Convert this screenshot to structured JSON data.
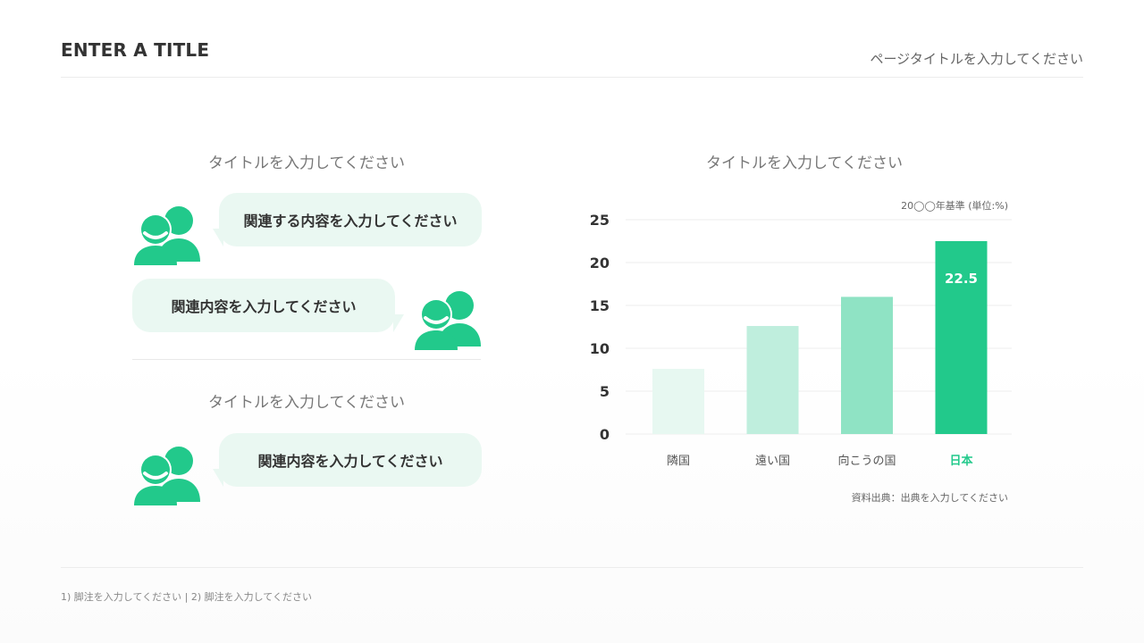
{
  "header": {
    "title": "ENTER A TITLE",
    "page_title": "ページタイトルを入力してください"
  },
  "left": {
    "section1": {
      "title": "タイトルを入力してください",
      "bubble1": "関連する内容を入力してください",
      "bubble2": "関連内容を入力してください"
    },
    "section2": {
      "title": "タイトルを入力してください",
      "bubble1": "関連内容を入力してください"
    }
  },
  "chart_section": {
    "title": "タイトルを入力してください",
    "note": "20◯◯年基準 (単位:%)",
    "source": "資料出典：出典を入力してください"
  },
  "chart_data": {
    "type": "bar",
    "title": "タイトルを入力してください",
    "categories": [
      "隣国",
      "遠い国",
      "向こうの国",
      "日本"
    ],
    "values": [
      7.6,
      12.6,
      16.0,
      22.5
    ],
    "ylim": [
      0,
      25
    ],
    "yticks": [
      0,
      5,
      10,
      15,
      20,
      25
    ],
    "grid": true,
    "highlight_index": 3,
    "highlight_label": "22.5",
    "colors": [
      "#e7f8f1",
      "#bfeedd",
      "#8fe3c4",
      "#22c98b"
    ],
    "highlight_color": "#22c98b"
  },
  "footer": {
    "footnote": "1) 脚注を入力してください | 2) 脚注を入力してください"
  },
  "colors": {
    "accent": "#22c98b",
    "bubble_bg": "#eaf8f2"
  }
}
